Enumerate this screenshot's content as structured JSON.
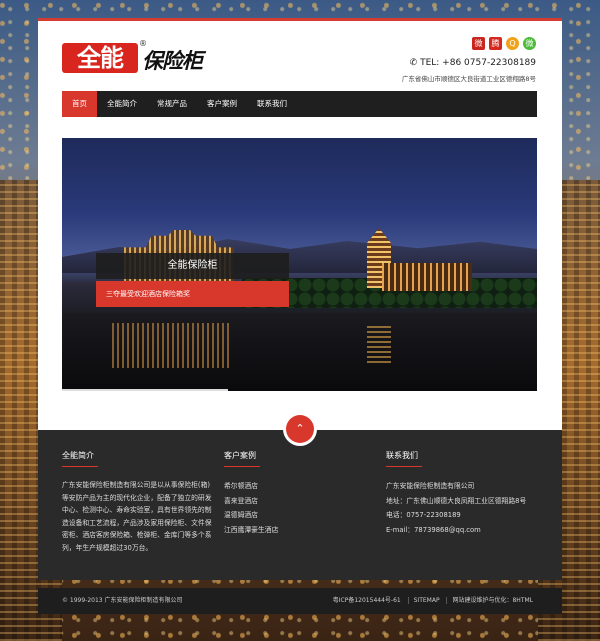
{
  "header": {
    "logo_mark": "全能",
    "logo_text": "保险柜",
    "logo_reg": "®",
    "social": [
      {
        "name": "weibo-icon",
        "glyph": "微"
      },
      {
        "name": "tencent-weibo-icon",
        "glyph": "腾"
      },
      {
        "name": "qq-icon",
        "glyph": "Q"
      },
      {
        "name": "wechat-icon",
        "glyph": "微"
      }
    ],
    "tel": "TEL: +86 0757-22308189",
    "address": "广东省佛山市顺德区大良街道工业区德翔路8号"
  },
  "nav": {
    "items": [
      "首页",
      "全能简介",
      "常规产品",
      "客户案例",
      "联系我们"
    ],
    "active": "首页"
  },
  "banner": {
    "title": "全能保险柜",
    "subtitle": "三夺最受欢迎酒店保险箱奖"
  },
  "footer": {
    "about": {
      "heading": "全能简介",
      "text": "广东安能保险柜制造有限公司是以从事保险柜(箱)等安防产品为主的现代化企业，配备了独立的研发中心、检测中心、寿命实验室，具有世界领先的制造设备和工艺流程，产品涉及家用保险柜、文件保密柜、酒店客房保险箱、枪弹柜、金库门等多个系列，年生产规模超过30万台。"
    },
    "cases": {
      "heading": "客户案例",
      "items": [
        "希尔顿酒店",
        "喜来登酒店",
        "温德姆酒店",
        "江西鹰潭豪生酒店"
      ]
    },
    "contact": {
      "heading": "联系我们",
      "items": [
        "广东安能保险柜制造有限公司",
        "地址：广东佛山顺德大良凤翔工业区德翔路8号",
        "电话：0757-22308189",
        "E-mail：78739868@qq.com"
      ]
    }
  },
  "bottom": {
    "copyright": "© 1999-2013 广东安能保险柜制造有限公司",
    "icp": "粤ICP备12015444号-61",
    "sitemap": "SITEMAP",
    "credit": "网站建设维护与优化：8HTML"
  }
}
